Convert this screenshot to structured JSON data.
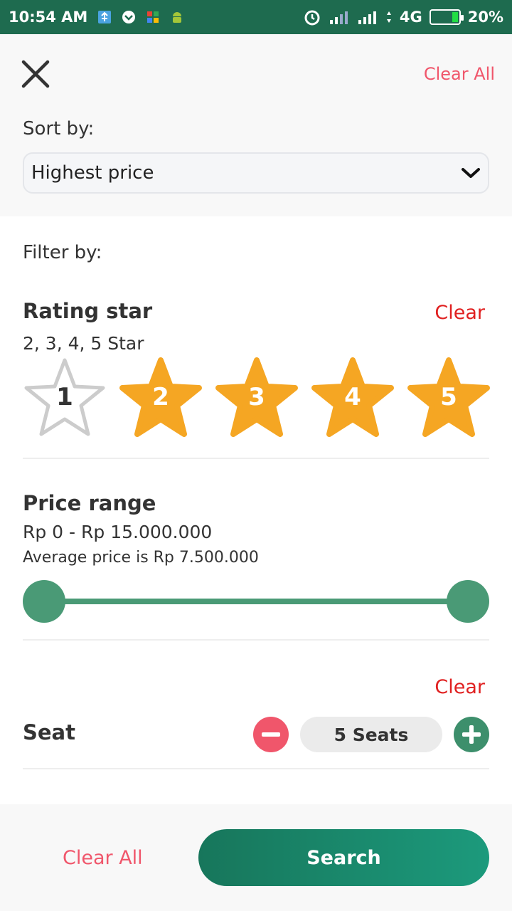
{
  "status_bar": {
    "time": "10:54 AM",
    "network": "4G",
    "battery": "20%"
  },
  "header": {
    "clear_all": "Clear All"
  },
  "sort": {
    "label": "Sort by:",
    "selected": "Highest price"
  },
  "filter": {
    "label": "Filter by:",
    "rating": {
      "title": "Rating star",
      "clear": "Clear",
      "summary": "2, 3, 4, 5 Star",
      "stars": [
        {
          "label": "1",
          "selected": false
        },
        {
          "label": "2",
          "selected": true
        },
        {
          "label": "3",
          "selected": true
        },
        {
          "label": "4",
          "selected": true
        },
        {
          "label": "5",
          "selected": true
        }
      ]
    },
    "price": {
      "title": "Price range",
      "range": "Rp 0 - Rp 15.000.000",
      "average": "Average price is Rp 7.500.000",
      "slider_min_fraction": 0,
      "slider_max_fraction": 1
    },
    "seat": {
      "title": "Seat",
      "clear": "Clear",
      "value": "5 Seats"
    }
  },
  "footer": {
    "clear_all": "Clear All",
    "search": "Search"
  },
  "colors": {
    "status_bar": "#1e6b4f",
    "accent_green": "#4a9a76",
    "star_selected": "#f5a623",
    "clear_pink": "#f0566b",
    "clear_red": "#e02020"
  }
}
